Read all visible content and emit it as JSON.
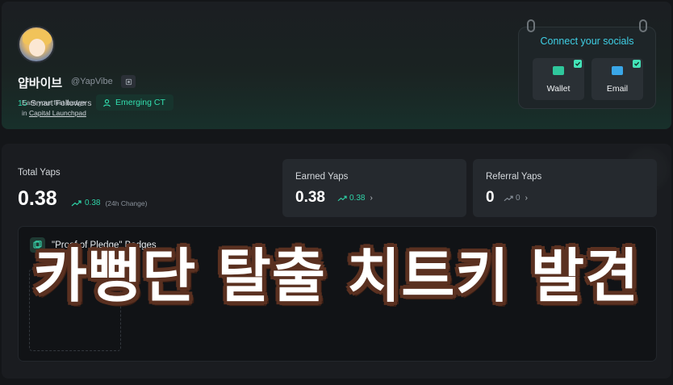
{
  "profile": {
    "display_name": "얍바이브",
    "handle": "@YapVibe",
    "followers_count": "15",
    "followers_label": "Smart Followers",
    "tier": "Emerging CT"
  },
  "socials": {
    "title": "Connect your socials",
    "items": [
      {
        "label": "Wallet",
        "icon": "wallet-icon",
        "connected": true
      },
      {
        "label": "Email",
        "icon": "mail-icon",
        "connected": true
      }
    ]
  },
  "stats": {
    "total": {
      "label": "Total Yaps",
      "value": "0.38",
      "change": "0.38",
      "change_note": "(24h Change)"
    },
    "earned": {
      "label": "Earned Yaps",
      "value": "0.38",
      "change": "0.38",
      "chevron": "›"
    },
    "referral": {
      "label": "Referral Yaps",
      "value": "0",
      "change": "0",
      "chevron": "›"
    }
  },
  "badges": {
    "title": "\"Proof of Pledge\" Badges",
    "empty_line1": "Earn your first badge",
    "empty_line2_prefix": "in ",
    "empty_line2_link": "Capital Launchpad"
  },
  "overlay_text": "카뻥단 탈출 치트키 발견",
  "colors": {
    "accent": "#2fd4a8",
    "socials_title": "#3fd0e6",
    "overlay_outline": "#5a3020"
  }
}
